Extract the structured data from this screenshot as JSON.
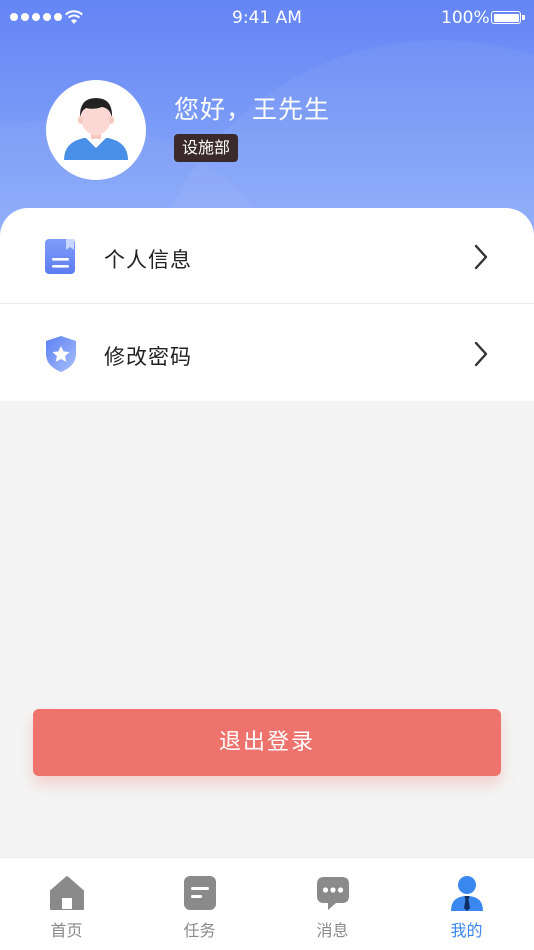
{
  "status_bar": {
    "time": "9:41 AM",
    "battery": "100%"
  },
  "profile": {
    "greeting": "您好，王先生",
    "department": "设施部"
  },
  "menu": {
    "items": [
      {
        "label": "个人信息",
        "icon": "document-icon"
      },
      {
        "label": "修改密码",
        "icon": "shield-star-icon"
      }
    ]
  },
  "logout": {
    "label": "退出登录"
  },
  "tabbar": {
    "items": [
      {
        "label": "首页",
        "icon": "home-icon"
      },
      {
        "label": "任务",
        "icon": "task-icon"
      },
      {
        "label": "消息",
        "icon": "chat-icon"
      },
      {
        "label": "我的",
        "icon": "user-icon"
      }
    ],
    "active_index": 3
  },
  "colors": {
    "header_start": "#6485f5",
    "header_end": "#93b0fb",
    "logout_bg": "#ee736d",
    "tab_active": "#3b87f0",
    "tab_inactive": "#8a8a8a",
    "badge_bg": "#3a2a2c"
  }
}
